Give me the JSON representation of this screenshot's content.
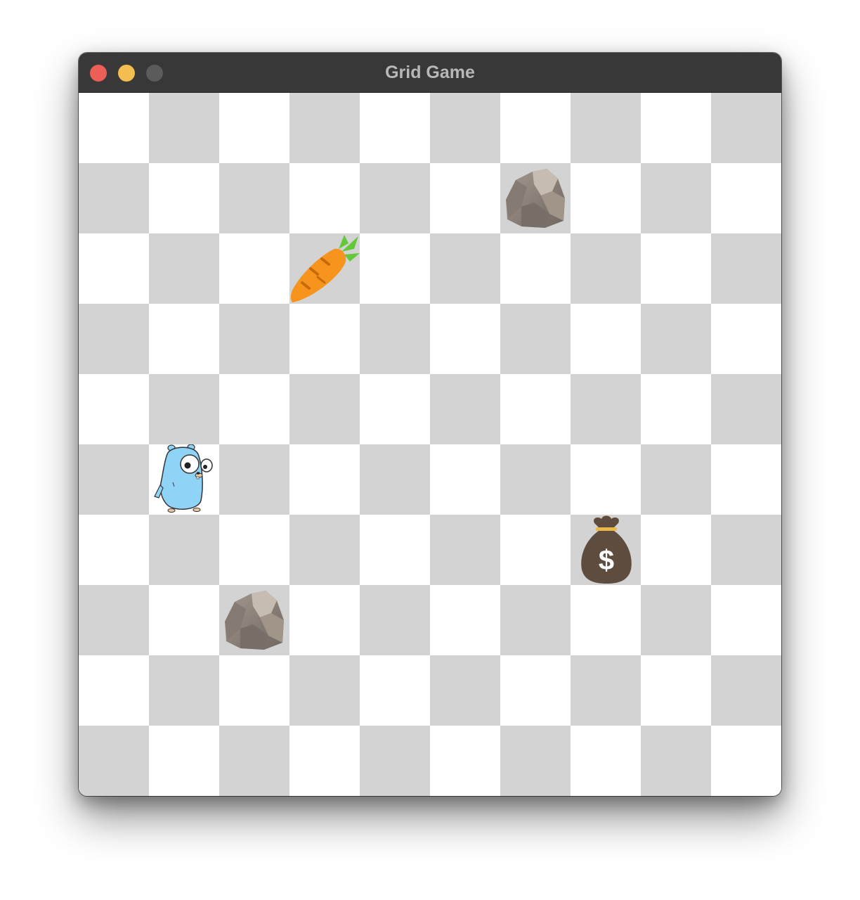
{
  "window": {
    "title": "Grid Game"
  },
  "board": {
    "columns": 10,
    "rows": 10,
    "colors": {
      "light": "#ffffff",
      "dark": "#d3d3d3"
    },
    "entities": [
      {
        "type": "rock",
        "icon": "rock-icon",
        "col": 6,
        "row": 1
      },
      {
        "type": "carrot",
        "icon": "carrot-icon",
        "col": 3,
        "row": 2
      },
      {
        "type": "player",
        "icon": "gopher-icon",
        "col": 1,
        "row": 5
      },
      {
        "type": "money-bag",
        "icon": "money-bag-icon",
        "col": 7,
        "row": 6
      },
      {
        "type": "rock",
        "icon": "rock-icon",
        "col": 2,
        "row": 7
      }
    ]
  }
}
